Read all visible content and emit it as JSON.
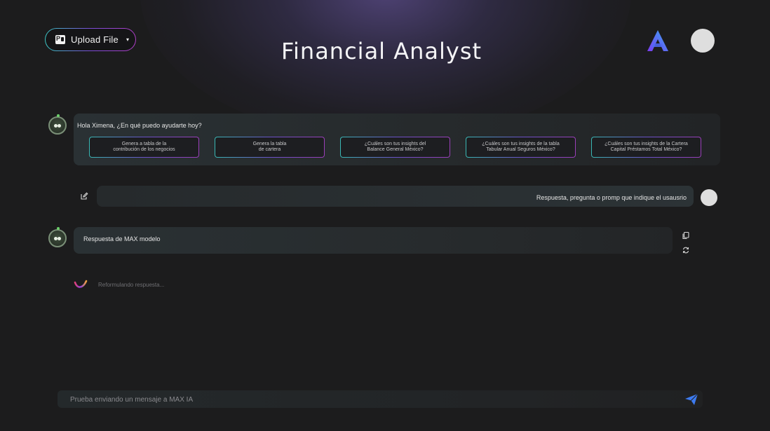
{
  "header": {
    "upload_label": "Upload File",
    "upload_caret": "▾",
    "title": "Financial Analyst"
  },
  "colors": {
    "background": "#1c1c1d",
    "accent_teal": "#3bc7c3",
    "accent_purple": "#7b4dd8",
    "accent_magenta": "#b03fc6",
    "send_blue": "#3d7bf0"
  },
  "icons": {
    "upload": "powerpoint-icon",
    "logo": "app-logo",
    "edit": "edit-icon",
    "copy": "copy-icon",
    "regenerate": "regenerate-icon",
    "send": "send-icon",
    "loader": "loader-icon"
  },
  "greeting": {
    "text": "Hola Ximena, ¿En qué puedo ayudarte hoy?",
    "suggestions": [
      "Genera a tabla de la\ncontribución de los negocios",
      "Genera la tabla\nde cartera",
      "¿Cuáles son tus insights del\nBalance General México?",
      "¿Cuáles son tus insights de la tabla\nTabular Anual Seguros México?",
      "¿Cuáles son tus insights de la Cartera\nCapital Préstamos Total México?"
    ]
  },
  "user_message": {
    "text": "Respuesta, pregunta o promp que indique el usausrio"
  },
  "bot_response": {
    "text": "Respuesta de MAX modelo"
  },
  "loading": {
    "text": "Reformulando respuesta..."
  },
  "input": {
    "placeholder": "Prueba enviando un mensaje a MAX IA",
    "value": ""
  }
}
